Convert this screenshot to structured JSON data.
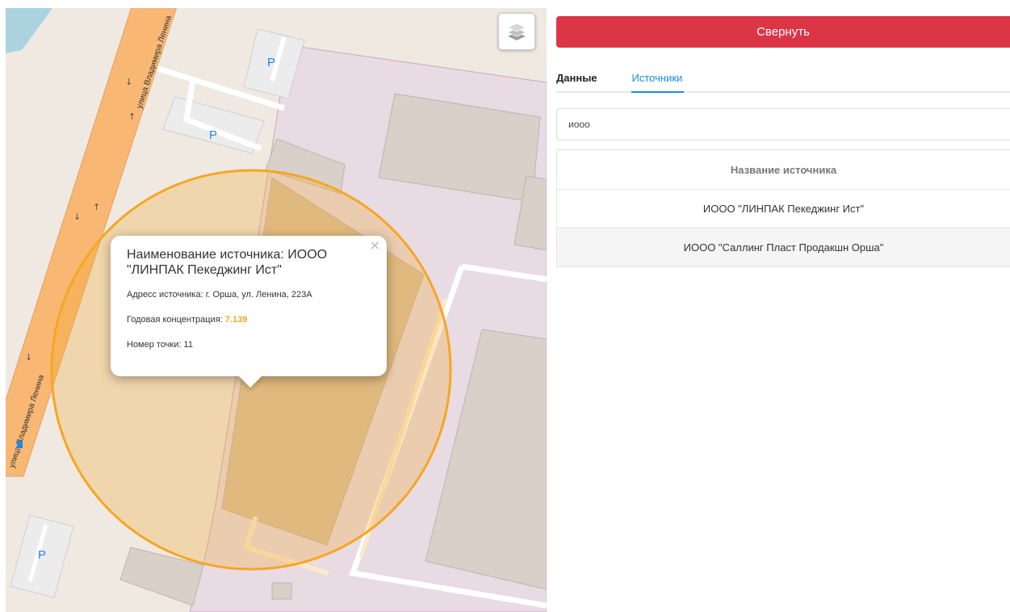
{
  "map": {
    "parking_label": "P",
    "street_labels": [
      "улица Владимира Ленина",
      "улица Владимира Ленина"
    ],
    "layers_button": "layers-icon",
    "popup": {
      "title": "Наименование источника: ИООО \"ЛИНПАК Пекеджинг Ист\"",
      "address_label": "Адресс источника:",
      "address_value": "г. Орша, ул. Ленина, 223А",
      "concentration_label": "Годовая концентрация:",
      "concentration_value": "7.139",
      "point_label": "Номер точки:",
      "point_value": "11",
      "close_symbol": "×"
    },
    "colors": {
      "circle_stroke": "#f5a623",
      "road": "#f9b774",
      "industrial": "#e9dbe3",
      "building": "#d9d0c9"
    }
  },
  "panel": {
    "collapse_label": "Свернуть",
    "tabs": [
      {
        "label": "Данные",
        "active": false
      },
      {
        "label": "Источники",
        "active": true
      }
    ],
    "search_value": "иооо",
    "table": {
      "header": "Название источника",
      "rows": [
        "ИООО \"ЛИНПАК Пекеджинг Ист\"",
        "ИООО \"Саллинг Пласт Продакшн Орша\""
      ]
    },
    "colors": {
      "collapse_bg": "#dc3545",
      "active_tab": "#1e88e5"
    }
  }
}
